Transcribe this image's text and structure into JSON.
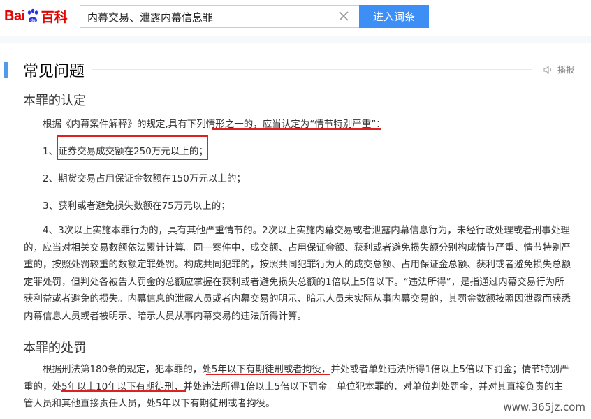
{
  "header": {
    "logo_bai": "Bai",
    "logo_du": "du",
    "logo_baike": "百科",
    "search_value": "内幕交易、泄露内幕信息罪",
    "enter_button": "进入词条"
  },
  "section": {
    "title": "常见问题",
    "speak_label": "播报"
  },
  "identification": {
    "heading": "本罪的认定",
    "intro": "根据《内幕案件解释》的规定,具有下列情形之一的，应当认定为“情节特别严重”：",
    "item1": "1、证券交易成交额在250万元以上的；",
    "item2": "2、期货交易占用保证金数额在150万元以上的；",
    "item3": "3、获利或者避免损失数额在75万元以上的；",
    "item4": "4、3次以上实施本罪行为的，具有其他严重情节的。2次以上实施内幕交易或者泄露内幕信息行为，未经行政处理或者刑事处理的，应当对相关交易数额依法累计计算。同一案件中，成交额、占用保证金额、获利或者避免损失额分别构成情节严重、情节特别严重的，按照处罚较重的数额定罪处罚。构成共同犯罪的，按照共同犯罪行为人的成交总额、占用保证金总额、获利或者避免损失总额定罪处罚，但判处各被告人罚金的总额应掌握在获利或者避免损失总额的1倍以上5倍以下。“违法所得”，是指通过内幕交易行为所获利益或者避免的损失。内幕信息的泄露人员或者内幕交易的明示、暗示人员未实际从事内幕交易的，其罚金数额按照因泄露而获悉内幕信息人员或者被明示、暗示人员从事内幕交易的违法所得计算。"
  },
  "penalty": {
    "heading": "本罪的处罚",
    "text": "根据刑法第180条的规定，犯本罪的，处5年以下有期徒刑或者拘役，并处或者单处违法所得1倍以上5倍以下罚金；情节特别严重的，处5年以上10年以下有期徒刑，并处违法所得1倍以上5倍以下罚金。单位犯本罪的，对单位判处罚金，并对其直接负责的主管人员和其他直接责任人员，处5年以下有期徒刑或者拘役。"
  },
  "watermark": "www.365jz.com",
  "colors": {
    "brand_red": "#e10602",
    "button_blue": "#3d8ff5",
    "accent_blue": "#4f9cee",
    "annotation_red": "#e02020"
  }
}
